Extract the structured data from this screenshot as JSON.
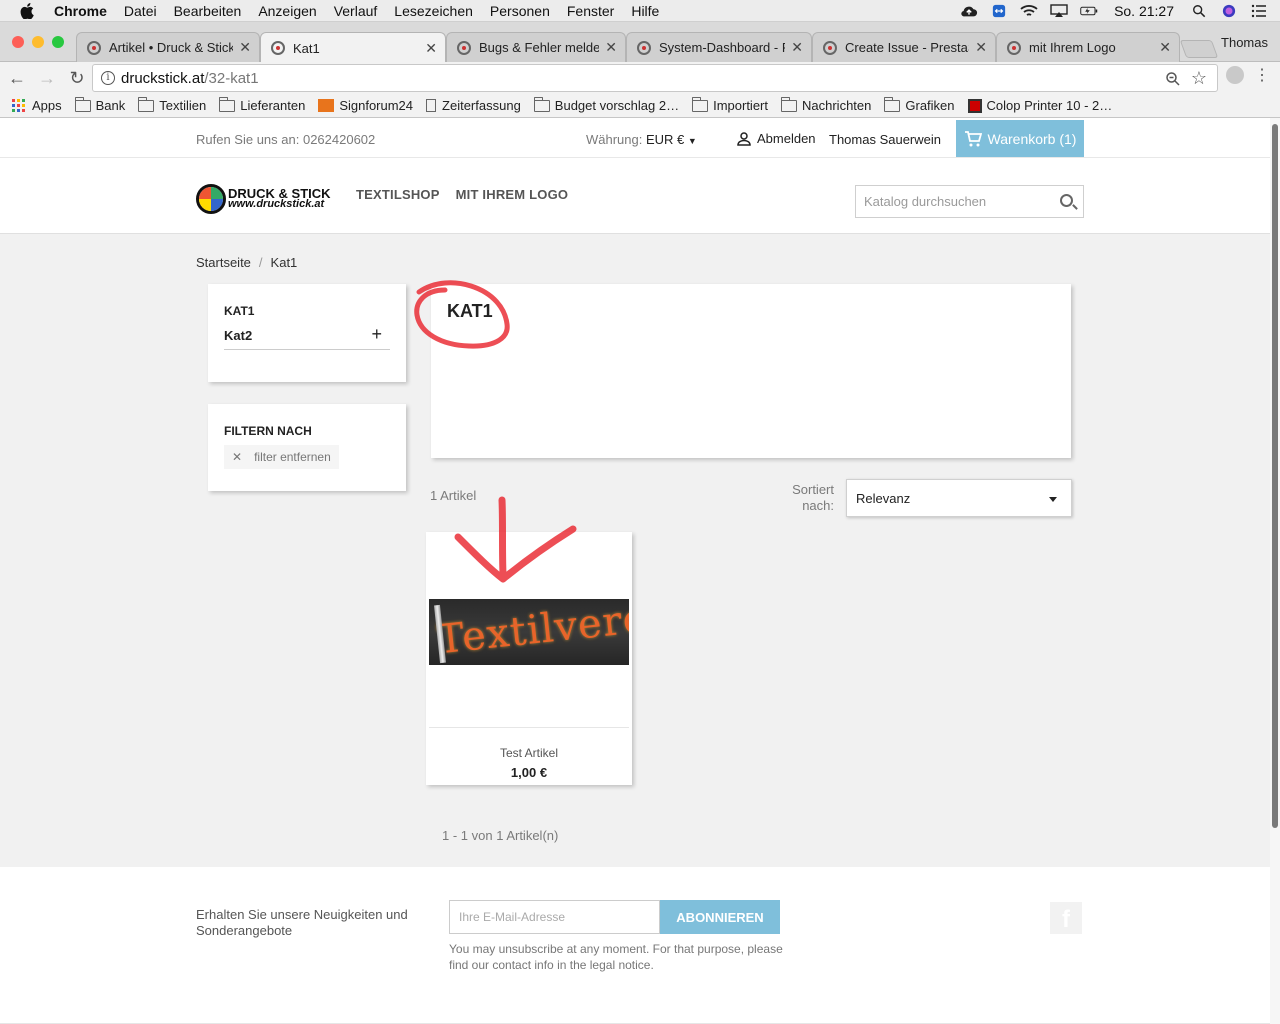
{
  "menubar": {
    "app_name": "Chrome",
    "items": [
      "Datei",
      "Bearbeiten",
      "Anzeigen",
      "Verlauf",
      "Lesezeichen",
      "Personen",
      "Fenster",
      "Hilfe"
    ],
    "clock": "So. 21:27"
  },
  "tabs": [
    {
      "title": "Artikel • Druck & Stick"
    },
    {
      "title": "Kat1"
    },
    {
      "title": "Bugs & Fehler melden"
    },
    {
      "title": "System-Dashboard - P"
    },
    {
      "title": "Create Issue - PrestaS"
    },
    {
      "title": "mit Ihrem Logo"
    }
  ],
  "profile_name": "Thomas",
  "address": {
    "host": "druckstick.at",
    "path": "/32-kat1"
  },
  "bookmarks": [
    "Apps",
    "Bank",
    "Textilien",
    "Lieferanten",
    "Signforum24",
    "Zeiterfassung",
    "Budget vorschlag 2…",
    "Importiert",
    "Nachrichten",
    "Grafiken",
    "Colop Printer 10 - 2…"
  ],
  "topbar": {
    "call_us": "Rufen Sie uns an: 0262420602",
    "currency_label": "Währung:",
    "currency_value": "EUR €",
    "logout": "Abmelden",
    "user_name": "Thomas Sauerwein",
    "cart": "Warenkorb (1)"
  },
  "header": {
    "logo_line1": "DRUCK & STICK",
    "logo_line2": "www.druckstick.at",
    "nav": [
      "TEXTILSHOP",
      "MIT IHREM LOGO"
    ],
    "search_placeholder": "Katalog durchsuchen"
  },
  "breadcrumb": [
    "Startseite",
    "Kat1"
  ],
  "sidebar": {
    "category_title": "KAT1",
    "subcategory": "Kat2",
    "filter_title": "FILTERN NACH",
    "filter_remove": "filter entfernen"
  },
  "category": {
    "title": "KAT1",
    "product_count": "1 Artikel",
    "sort_label": "Sortiert nach:",
    "sort_value": "Relevanz"
  },
  "product": {
    "image_text": "Textilvered",
    "name": "Test Artikel",
    "price": "1,00 €"
  },
  "pagination": "1 - 1 von 1 Artikel(n)",
  "footer": {
    "newsletter_text": "Erhalten Sie unsere Neuigkeiten und Sonderangebote",
    "email_placeholder": "Ihre E-Mail-Adresse",
    "subscribe": "ABONNIEREN",
    "legal": "You may unsubscribe at any moment. For that purpose, please find our contact info in the legal notice."
  },
  "colors": {
    "accent": "#7fbfdb",
    "annotation": "#e8222a"
  }
}
